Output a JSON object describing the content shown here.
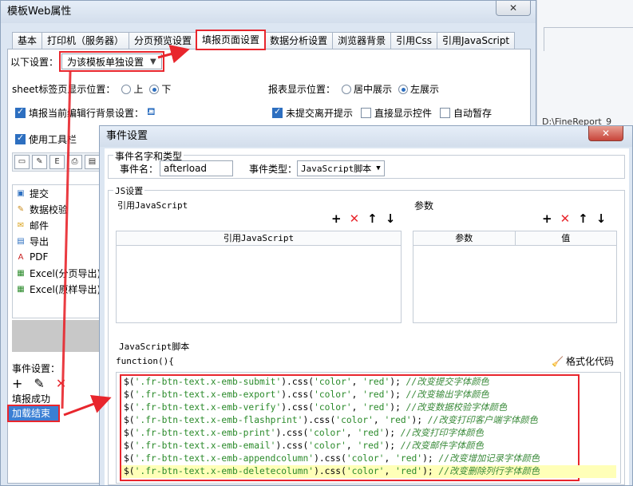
{
  "main_window": {
    "title": "模板Web属性",
    "close": "✕",
    "tabs": [
      "基本",
      "打印机（服务器）",
      "分页预览设置",
      "填报页面设置",
      "数据分析设置",
      "浏览器背景",
      "引用Css",
      "引用JavaScript"
    ],
    "active_tab_index": 3,
    "settings_label": "以下设置：",
    "settings_value": "为该模板单独设置",
    "sheet_pos_label": "sheet标签页显示位置：",
    "sheet_pos_options": [
      "上",
      "下"
    ],
    "sheet_pos_selected": "下",
    "report_pos_label": "报表显示位置：",
    "report_pos_options": [
      "居中展示",
      "左展示"
    ],
    "report_pos_selected": "左展示",
    "fill_bg_label": "填报当前编辑行背景设置：",
    "unsubmit_label": "未提交离开提示",
    "direct_show_label": "直接显示控件",
    "autosave_label": "自动暂存",
    "use_toolbar_label": "使用工具栏",
    "toolbar_buttons": [
      {
        "icon": "save-icon",
        "glyph": "▭"
      },
      {
        "icon": "edit-icon",
        "glyph": "✎"
      },
      {
        "icon": "export-icon",
        "glyph": "E"
      },
      {
        "icon": "print-icon",
        "glyph": "⎙"
      },
      {
        "icon": "more-icon",
        "glyph": "▤"
      }
    ],
    "button_list": [
      {
        "label": "提交",
        "icon": "submit-icon",
        "glyph": "▣",
        "color": "#2d6fc0"
      },
      {
        "label": "数据校验",
        "icon": "verify-icon",
        "glyph": "✎",
        "color": "#c98a1a"
      },
      {
        "label": "邮件",
        "icon": "email-icon",
        "glyph": "✉",
        "color": "#d9a21a"
      },
      {
        "label": "导出",
        "icon": "export-icon",
        "glyph": "▤",
        "color": "#2d6fc0"
      },
      {
        "label": "PDF",
        "icon": "pdf-icon",
        "glyph": "A",
        "color": "#c82020"
      },
      {
        "label": "Excel(分页导出)",
        "icon": "excel-icon",
        "glyph": "▦",
        "color": "#2a8a2a"
      },
      {
        "label": "Excel(原样导出)",
        "icon": "excel-icon",
        "glyph": "▦",
        "color": "#2a8a2a"
      }
    ],
    "event_settings_label": "事件设置：",
    "event_items": [
      "填报成功",
      "加载结束"
    ],
    "selected_event_index": 1
  },
  "background": {
    "path_text": "D:\\FineReport_9"
  },
  "dialog": {
    "title": "事件设置",
    "close": "✕",
    "name_group_label": "事件名字和类型",
    "event_name_label": "事件名：",
    "event_name_value": "afterload",
    "event_type_label": "事件类型：",
    "event_type_value": "JavaScript脚本",
    "js_group_label": "JS设置",
    "ref_js_label": "引用JavaScript",
    "params_label": "参数",
    "ref_js_col": "引用JavaScript",
    "param_cols": [
      "参数",
      "值"
    ],
    "script_label": "JavaScript脚本",
    "format_label": "格式化代码",
    "function_header": "function(){",
    "code_lines": [
      {
        "sel": "'.fr-btn-text.x-emb-submit'",
        "comment": "//改变提交字体颜色"
      },
      {
        "sel": "'.fr-btn-text.x-emb-export'",
        "comment": "//改变输出字体颜色"
      },
      {
        "sel": "'.fr-btn-text.x-emb-verify'",
        "comment": "//改变数据校验字体颜色"
      },
      {
        "sel": "'.fr-btn-text.x-emb-flashprint'",
        "comment": "//改变打印客户端字体颜色"
      },
      {
        "sel": "'.fr-btn-text.x-emb-print'",
        "comment": "//改变打印字体颜色"
      },
      {
        "sel": "'.fr-btn-text.x-emb-email'",
        "comment": "//改变邮件字体颜色"
      },
      {
        "sel": "'.fr-btn-text.x-emb-appendcolumn'",
        "comment": "//改变增加记录字体颜色"
      },
      {
        "sel": "'.fr-btn-text.x-emb-deletecolumn'",
        "comment": "//改变删除列行字体颜色"
      }
    ],
    "css_color_arg": "'color'",
    "css_value_arg": "'red'"
  },
  "colors": {
    "accent_red": "#e8262d",
    "selection_blue": "#3b7fd4"
  }
}
